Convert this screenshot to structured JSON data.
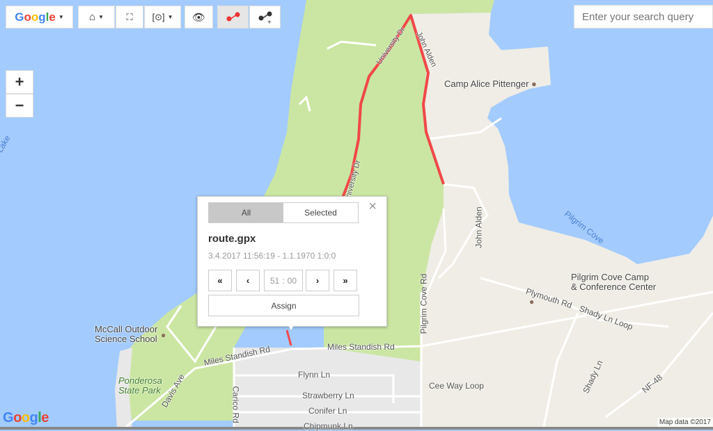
{
  "toolbar": {
    "map_provider": "Google",
    "buttons": [
      {
        "icon": "home-icon"
      },
      {
        "icon": "fit-bounds-icon"
      },
      {
        "icon": "locate-icon"
      },
      {
        "icon": "eye-icon"
      },
      {
        "icon": "route-icon",
        "active": true
      },
      {
        "icon": "add-route-point-icon"
      }
    ]
  },
  "search": {
    "placeholder": "Enter your search query",
    "value": ""
  },
  "zoom": {
    "in": "+",
    "out": "−"
  },
  "popup": {
    "tabs": [
      {
        "label": "All",
        "active": true
      },
      {
        "label": "Selected",
        "active": false
      }
    ],
    "close": "×",
    "filename": "route.gpx",
    "time_range": "3.4.2017 11:56:19 - 1.1.1970 1:0:0",
    "first": "«",
    "prev": "‹",
    "next": "›",
    "last": "»",
    "minutes": "51",
    "seconds": "00",
    "separator": ":",
    "assign": "Assign"
  },
  "map": {
    "colors": {
      "water": "#a3cbfd",
      "land": "#efede6",
      "park": "#cbe6a3",
      "residential": "#e8e8e8",
      "route": "#f04848"
    },
    "labels": {
      "lake": "Lake",
      "university_dr": "University Dr",
      "john_alden_top": "John Alden",
      "university_dr2": "University Dr",
      "camp_alice": "Camp Alice Pittenger",
      "pilgrim_cove": "Pilgrim Cove",
      "john_alden": "John Alden",
      "pilgrim_cove_rd": "Pilgrim Cove Rd",
      "pilgrim_camp_1": "Pilgrim Cove Camp",
      "pilgrim_camp_2": "& Conference Center",
      "plymouth": "Plymouth Rd",
      "shady_loop": "Shady Ln Loop",
      "shady": "Shady Ln",
      "nf48": "NF-48",
      "cee_way": "Cee Way Loop",
      "miles1": "Miles Standish Rd",
      "miles2": "Miles Standish Rd",
      "flynn": "Flynn Ln",
      "strawberry": "Strawberry Ln",
      "conifer": "Conifer Ln",
      "chipmunk": "Chipmunk Ln",
      "carico": "Carico Rd",
      "davis": "Davis Ave",
      "ponderosa_1": "Ponderosa",
      "ponderosa_2": "State Park",
      "mccall_1": "McCall Outdoor",
      "mccall_2": "Science School"
    },
    "attribution": "Map data ©2017",
    "logo": "Google"
  }
}
